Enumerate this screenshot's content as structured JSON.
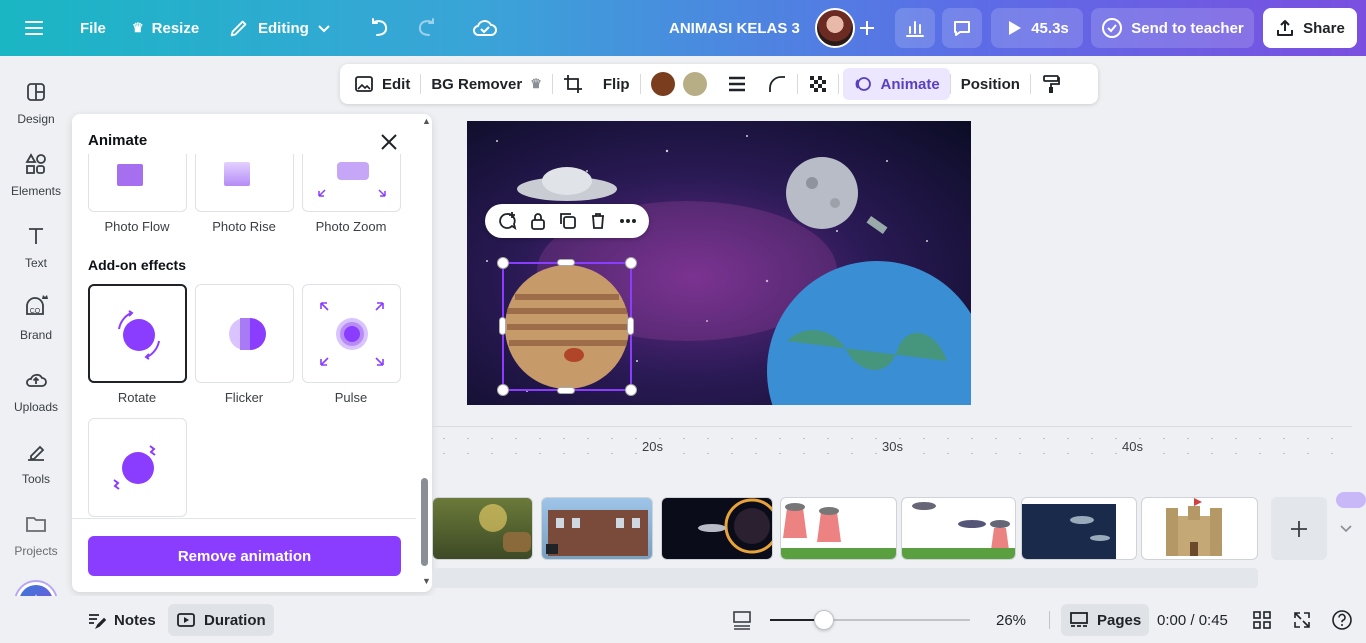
{
  "header": {
    "file_label": "File",
    "resize_label": "Resize",
    "editing_label": "Editing",
    "title": "ANIMASI KELAS 3",
    "play_duration": "45.3s",
    "send_label": "Send to teacher",
    "share_label": "Share"
  },
  "rail": {
    "items": [
      {
        "label": "Design",
        "icon": "design-icon"
      },
      {
        "label": "Elements",
        "icon": "elements-icon"
      },
      {
        "label": "Text",
        "icon": "text-icon"
      },
      {
        "label": "Brand",
        "icon": "brand-icon"
      },
      {
        "label": "Uploads",
        "icon": "uploads-icon"
      },
      {
        "label": "Tools",
        "icon": "tools-icon"
      },
      {
        "label": "Projects",
        "icon": "projects-icon"
      }
    ]
  },
  "toolbar": {
    "edit_label": "Edit",
    "bg_remover_label": "BG Remover",
    "flip_label": "Flip",
    "color1": "#7a3e1e",
    "color2": "#b7ae86",
    "animate_label": "Animate",
    "position_label": "Position"
  },
  "panel": {
    "title": "Animate",
    "photo_effects": [
      "Photo Flow",
      "Photo Rise",
      "Photo Zoom"
    ],
    "addon_heading": "Add-on effects",
    "addon_effects": [
      "Rotate",
      "Flicker",
      "Pulse"
    ],
    "remove_label": "Remove animation"
  },
  "timeline": {
    "ticks": [
      "20s",
      "30s",
      "40s"
    ]
  },
  "bottom": {
    "notes_label": "Notes",
    "duration_label": "Duration",
    "zoom": "26%",
    "pages_label": "Pages",
    "time": "0:00 / 0:45"
  },
  "colors": {
    "accent": "#8b3dff",
    "brand_gradient_start": "#1ab6c4",
    "brand_gradient_end": "#7a4fe0"
  }
}
